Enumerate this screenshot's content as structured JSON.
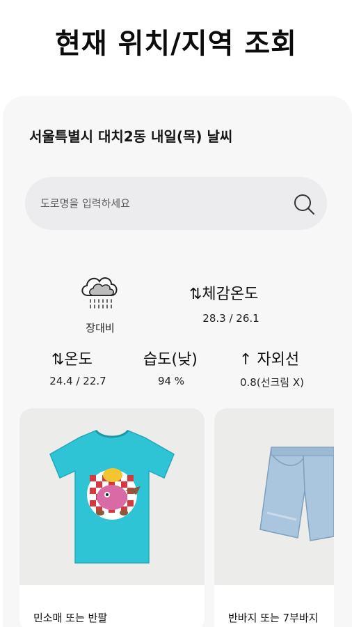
{
  "page": {
    "title": "현재 위치/지역 조회"
  },
  "weather": {
    "location_title": "서울특별시 대치2동 내일(목) 날씨",
    "search": {
      "placeholder": "도로명을 입력하세요"
    },
    "condition": {
      "icon": "rain-cloud-icon",
      "label": "장대비"
    },
    "feels_like": {
      "label": "⇅체감온도",
      "value": "28.3 / 26.1"
    },
    "temperature": {
      "label": "⇅온도",
      "value": "24.4 / 22.7"
    },
    "humidity": {
      "label": "습도(낮)",
      "value": "94 %"
    },
    "uv": {
      "label": "↑ 자외선",
      "value": "0.8(선크림 X)"
    }
  },
  "products": [
    {
      "name": "민소매 또는 반팔",
      "image": "graphic-tshirt-image",
      "color": "#2ec4d6"
    },
    {
      "name": "반바지 또는 7부바지",
      "image": "denim-shorts-image",
      "color": "#a9c6de"
    }
  ],
  "colors": {
    "background": "#ffffff",
    "card": "#f7f7f8",
    "search": "#ececee"
  }
}
